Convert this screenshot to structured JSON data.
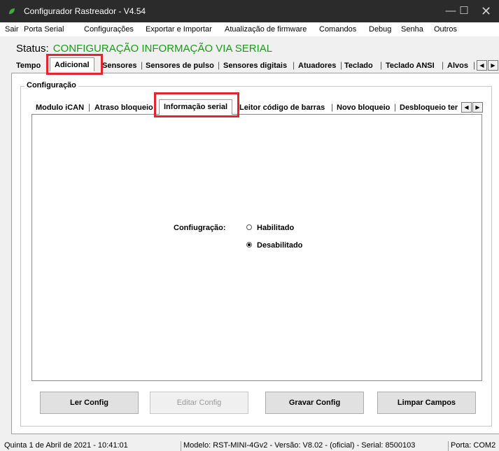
{
  "window": {
    "title": "Configurador Rastreador - V4.54",
    "min_glyph": "—",
    "max_glyph": "☐",
    "close_glyph": "✕"
  },
  "menu": [
    "Sair",
    "Porta Serial",
    "Configurações",
    "Exportar e Importar",
    "Atualização de firmware",
    "Comandos",
    "Debug",
    "Senha",
    "Outros"
  ],
  "status": {
    "label": "Status:",
    "value": "CONFIGURAÇÃO INFORMAÇÃO VIA SERIAL"
  },
  "main_tabs": [
    "Tempo",
    "Adicional",
    "Sensores",
    "Sensores de pulso",
    "Sensores digitais",
    "Atuadores",
    "Teclado",
    "Teclado ANSI",
    "Alvos"
  ],
  "main_tabs_selected": "Adicional",
  "group_title": "Configuração",
  "sub_tabs": [
    "Modulo iCAN",
    "Atraso bloqueio",
    "Informação serial",
    "Leitor código de barras",
    "Novo bloqueio",
    "Desbloqueio ter"
  ],
  "sub_tabs_selected": "Informação serial",
  "form": {
    "field_label": "Confiugração:",
    "options": [
      "Habilitado",
      "Desabilitado"
    ],
    "selected": "Desabilitado"
  },
  "buttons": {
    "read": "Ler Config",
    "edit": "Editar Config",
    "write": "Gravar Config",
    "clear": "Limpar Campos"
  },
  "statusbar": {
    "datetime": "Quinta 1 de Abril de 2021  -  10:41:01",
    "device": "Modelo: RST-MINI-4Gv2  -  Versão: V8.02 - (oficial)  -  Serial: 8500103",
    "port": "Porta: COM2"
  },
  "colors": {
    "status_value": "#1a9a1a",
    "highlight": "#e3262b",
    "titlebar": "#2b2b2b"
  },
  "icons": {
    "app": "leaf-icon",
    "tab_scroll_left": "arrow-left-icon",
    "tab_scroll_right": "arrow-right-icon"
  }
}
